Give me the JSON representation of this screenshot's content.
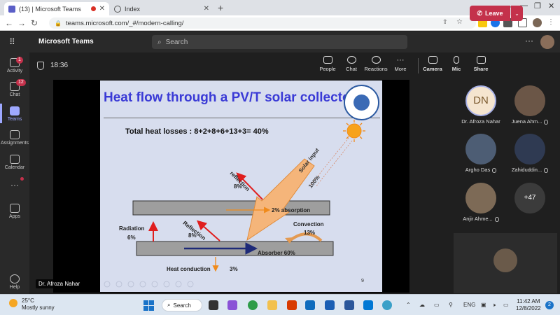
{
  "browser": {
    "tabs": [
      {
        "title": "(13) | Microsoft Teams",
        "active": true
      },
      {
        "title": "Index",
        "active": false
      }
    ],
    "url": "teams.microsoft.com/_#/modern-calling/"
  },
  "teams": {
    "app_name": "Microsoft Teams",
    "search_placeholder": "Search"
  },
  "rail": {
    "items": [
      {
        "label": "Activity",
        "badge": "1"
      },
      {
        "label": "Chat",
        "badge": "12"
      },
      {
        "label": "Teams"
      },
      {
        "label": "Assignments"
      },
      {
        "label": "Calendar"
      },
      {
        "label": "Apps"
      },
      {
        "label": "Help"
      }
    ]
  },
  "meeting": {
    "timer": "18:36",
    "controls": [
      "People",
      "Chat",
      "Reactions",
      "More",
      "Camera",
      "Mic",
      "Share"
    ],
    "leave_label": "Leave",
    "presenter": "Dr. Afroza Nahar"
  },
  "slide": {
    "title": "Heat flow through a PV/T solar collector",
    "heat_losses": "Total heat losses : 8+2+8+6+13+3= 40%",
    "labels": {
      "reflection_top": "reflection",
      "reflection_top_pct": "8%",
      "solar_input": "Solar input",
      "solar_input_pct": "100%",
      "absorption": "2% absorption",
      "radiation": "Radiation",
      "radiation_pct": "6%",
      "reflection_mid": "Reflection",
      "reflection_mid_pct": "8%",
      "convection": "Convection",
      "convection_pct": "13%",
      "absorber": "Absorber 60%",
      "conduction": "Heat conduction",
      "conduction_pct": "3%"
    },
    "page_number": "9"
  },
  "participants": [
    {
      "name": "Dr. Afroza Nahar",
      "initials": "DN"
    },
    {
      "name": "Juena Ahm..."
    },
    {
      "name": "Argho Das"
    },
    {
      "name": "Zahiduddin..."
    },
    {
      "name": "Anjir Ahme..."
    },
    {
      "name": "+47"
    }
  ],
  "taskbar": {
    "temperature": "25°C",
    "weather": "Mostly sunny",
    "search_label": "Search",
    "language": "ENG",
    "time": "11:42 AM",
    "date": "12/8/2022",
    "notifications": "2"
  },
  "colors": {
    "teams_dark": "#292929",
    "leave_red": "#c4314b",
    "teams_accent": "#9ea8ff",
    "slide_title": "#3a3ad6"
  }
}
